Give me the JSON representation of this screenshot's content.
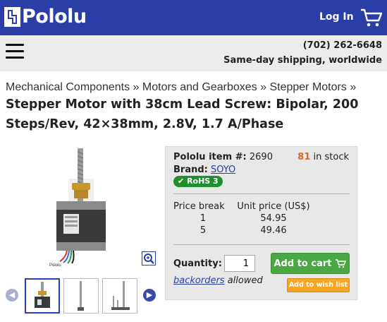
{
  "header": {
    "brand": "Pololu",
    "login_label": "Log In",
    "brand_color": "#2a3ea8"
  },
  "subheader": {
    "phone": "(702) 262-6648",
    "shipping": "Same-day shipping, worldwide"
  },
  "breadcrumb": {
    "items": [
      "Mechanical Components",
      "Motors and Gearboxes",
      "Stepper Motors"
    ],
    "separator": "»"
  },
  "product": {
    "title": "Stepper Motor with 38cm Lead Screw: Bipolar, 200 Steps/Rev, 42×38mm, 2.8V, 1.7 A/Phase",
    "image_caption": "Pololu",
    "item_label": "Pololu item #:",
    "item_number": "2690",
    "stock_count": "81",
    "stock_label": "in stock",
    "brand_label": "Brand:",
    "brand_name": "SOYO",
    "rohs_label": "RoHS 3",
    "price_table": {
      "headers": [
        "Price break",
        "Unit price (US$)"
      ],
      "rows": [
        {
          "break": "1",
          "price": "54.95"
        },
        {
          "break": "5",
          "price": "49.46"
        }
      ]
    },
    "quantity_label": "Quantity:",
    "quantity_value": "1",
    "add_to_cart_label": "Add to cart",
    "backorders_link": "backorders",
    "backorders_suffix": "allowed",
    "wishlist_label": "Add to wish list"
  },
  "colors": {
    "stock": "#e0662a",
    "add_to_cart": "#4aa843",
    "wishlist": "#f5a623",
    "rohs": "#1f8f2f"
  }
}
